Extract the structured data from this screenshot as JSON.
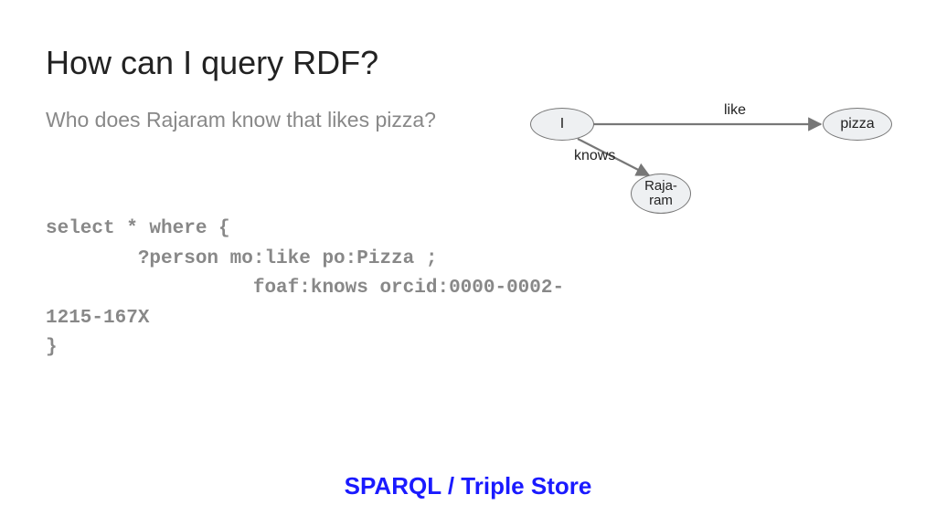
{
  "title": "How can I query RDF?",
  "subtitle": "Who does Rajaram know that likes pizza?",
  "code": "select * where {\n        ?person mo:like po:Pizza ;\n                  foaf:knows orcid:0000-0002-\n1215-167X\n}",
  "footer": "SPARQL / Triple Store",
  "graph": {
    "nodes": {
      "i": "I",
      "pizza": "pizza",
      "rajaram": "Raja-\nram"
    },
    "edges": {
      "like": "like",
      "knows": "knows"
    }
  }
}
